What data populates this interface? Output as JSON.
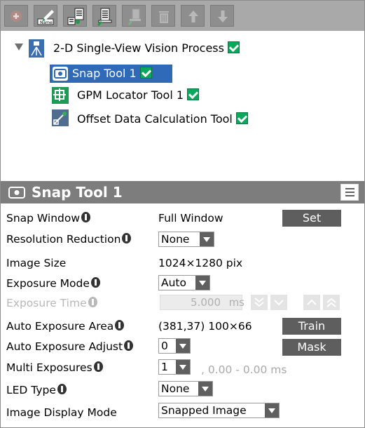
{
  "toolbar": {
    "buttons": [
      {
        "name": "add-plus-icon",
        "enabled": false
      },
      {
        "name": "rename-icon",
        "enabled": true,
        "label": "Name"
      },
      {
        "name": "add-list-icon",
        "enabled": true
      },
      {
        "name": "edit-list-icon",
        "enabled": true
      },
      {
        "name": "paste-icon",
        "enabled": false
      },
      {
        "name": "delete-icon",
        "enabled": false
      },
      {
        "name": "arrow-up-icon",
        "enabled": false
      },
      {
        "name": "arrow-down-icon",
        "enabled": false
      }
    ]
  },
  "tree": {
    "root": {
      "label": "2-D Single-View Vision Process",
      "icon": "vision-process-icon",
      "checked": true
    },
    "children": [
      {
        "label": "Snap Tool 1",
        "icon": "camera-icon",
        "checked": true,
        "selected": true
      },
      {
        "label": "GPM Locator Tool 1",
        "icon": "locator-icon",
        "checked": true
      },
      {
        "label": "Offset Data Calculation Tool",
        "icon": "offset-calc-icon",
        "checked": true
      }
    ]
  },
  "panel": {
    "title": "Snap Tool 1",
    "icon": "camera-icon",
    "menu_icon": "menu-icon"
  },
  "props": {
    "snap_window": {
      "label": "Snap Window",
      "value": "Full Window",
      "button": "Set"
    },
    "resolution_reduction": {
      "label": "Resolution Reduction",
      "value": "None"
    },
    "image_size": {
      "label": "Image Size",
      "value": "1024×1280  pix"
    },
    "exposure_mode": {
      "label": "Exposure Mode",
      "value": "Auto"
    },
    "exposure_time": {
      "label": "Exposure Time",
      "value": "5.000",
      "unit": "ms",
      "enabled": false
    },
    "auto_exposure_area": {
      "label": "Auto Exposure Area",
      "value": "(381,37) 100×66",
      "button": "Train"
    },
    "auto_exposure_adjust": {
      "label": "Auto Exposure Adjust",
      "value": "0",
      "button": "Mask"
    },
    "multi_exposures": {
      "label": "Multi Exposures",
      "value": "1",
      "range": ", 0.00  - 0.00  ms"
    },
    "led_type": {
      "label": "LED Type",
      "value": "None"
    },
    "image_display_mode": {
      "label": "Image Display Mode",
      "value": "Snapped Image"
    }
  },
  "colors": {
    "toolbar_bg": "#a9a9a9",
    "header_bg": "#7d7d7d",
    "selection": "#2f6ab8",
    "check": "#0aa85a",
    "button": "#5e5e5e"
  }
}
